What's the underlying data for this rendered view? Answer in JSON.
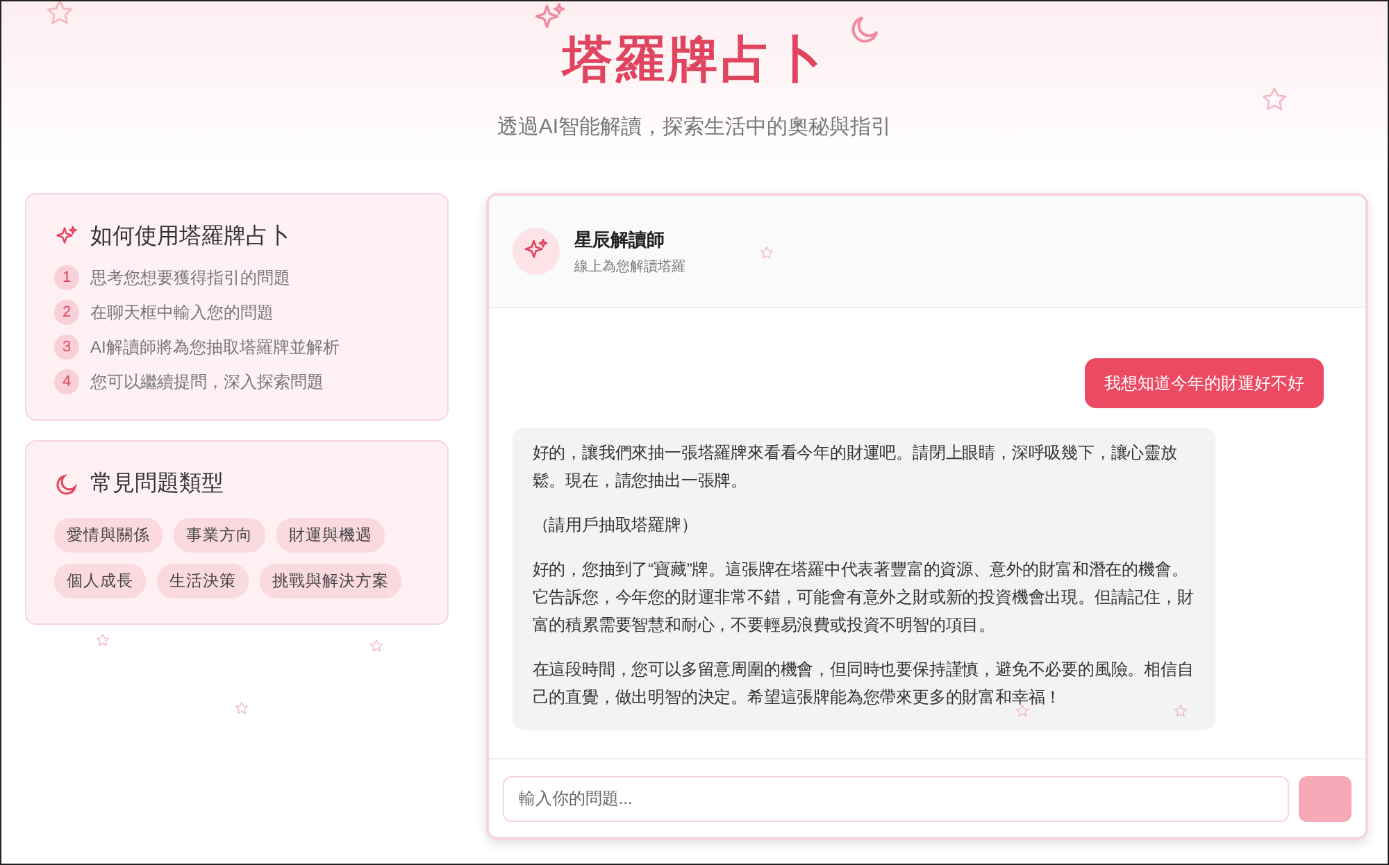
{
  "header": {
    "title": "塔羅牌占卜",
    "subtitle": "透過AI智能解讀，探索生活中的奧秘與指引"
  },
  "guide": {
    "title": "如何使用塔羅牌占卜",
    "steps": [
      {
        "number": "1",
        "text": "思考您想要獲得指引的問題"
      },
      {
        "number": "2",
        "text": "在聊天框中輸入您的問題"
      },
      {
        "number": "3",
        "text": "AI解讀師將為您抽取塔羅牌並解析"
      },
      {
        "number": "4",
        "text": "您可以繼續提問，深入探索問題"
      }
    ]
  },
  "topics": {
    "title": "常見問題類型",
    "tags": [
      "愛情與關係",
      "事業方向",
      "財運與機遇",
      "個人成長",
      "生活決策",
      "挑戰與解決方案"
    ]
  },
  "chat": {
    "assistant_name": "星辰解讀師",
    "assistant_status": "線上為您解讀塔羅",
    "messages": [
      {
        "kind": "user",
        "paragraphs": [
          "我想知道今年的財運好不好"
        ]
      },
      {
        "kind": "assistant",
        "paragraphs": [
          "好的，讓我們來抽一張塔羅牌來看看今年的財運吧。請閉上眼睛，深呼吸幾下，讓心靈放鬆。現在，請您抽出一張牌。",
          "（請用戶抽取塔羅牌）",
          "好的，您抽到了“寶藏”牌。這張牌在塔羅中代表著豐富的資源、意外的財富和潛在的機會。它告訴您，今年您的財運非常不錯，可能會有意外之財或新的投資機會出現。但請記住，財富的積累需要智慧和耐心，不要輕易浪費或投資不明智的項目。",
          "在這段時間，您可以多留意周圍的機會，但同時也要保持謹慎，避免不必要的風險。相信自己的直覺，做出明智的決定。希望這張牌能為您帶來更多的財富和幸福！"
        ]
      }
    ],
    "input": {
      "placeholder": "輸入你的問題..."
    },
    "send_button": {
      "disabled": true
    }
  }
}
